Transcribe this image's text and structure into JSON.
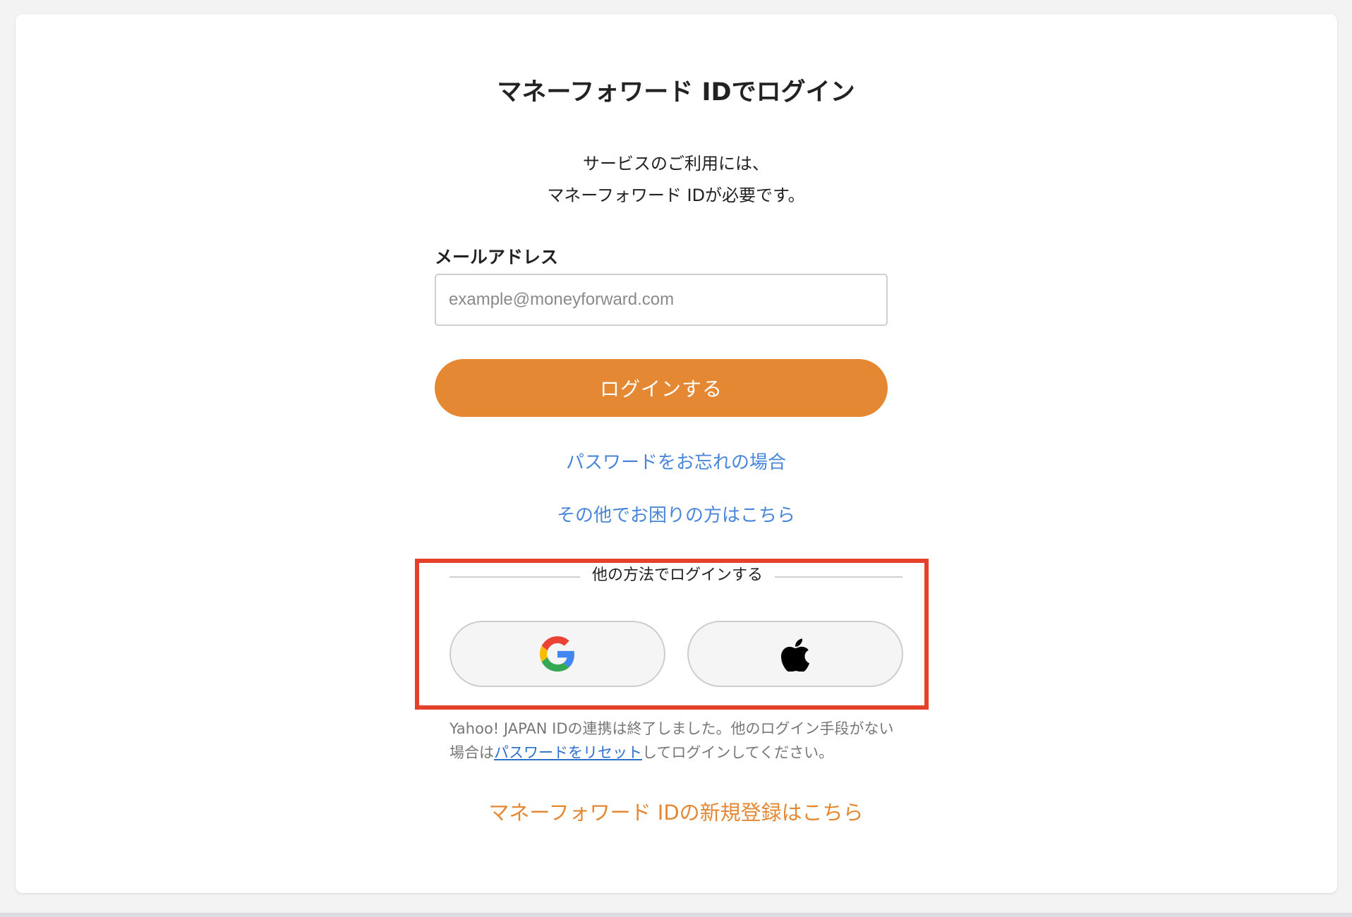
{
  "page": {
    "title": "マネーフォワード IDでログイン",
    "intro_line1": "サービスのご利用には、",
    "intro_line2": "マネーフォワード IDが必要です。"
  },
  "login_form": {
    "email_label": "メールアドレス",
    "email_placeholder": "example@moneyforward.com",
    "email_value": "",
    "submit_label": "ログインする"
  },
  "help_links": {
    "forgot_password": "パスワードをお忘れの場合",
    "other_trouble": "その他でお困りの方はこちら"
  },
  "alt_login": {
    "divider_label": "他の方法でログインする",
    "providers": [
      {
        "name": "Google",
        "icon": "google-icon"
      },
      {
        "name": "Apple",
        "icon": "apple-icon"
      }
    ]
  },
  "yahoo_note": {
    "text_before": "Yahoo! JAPAN IDの連携は終了しました。他のログイン手段がない場合は",
    "link_text": "パスワードをリセット",
    "text_after": "してログインしてください。"
  },
  "register": {
    "label": "マネーフォワード IDの新規登録はこちら"
  },
  "colors": {
    "accent_orange": "#e48833",
    "link_blue": "#4a86d8",
    "highlight_red": "#e5402a",
    "background": "#f3f3f3"
  }
}
